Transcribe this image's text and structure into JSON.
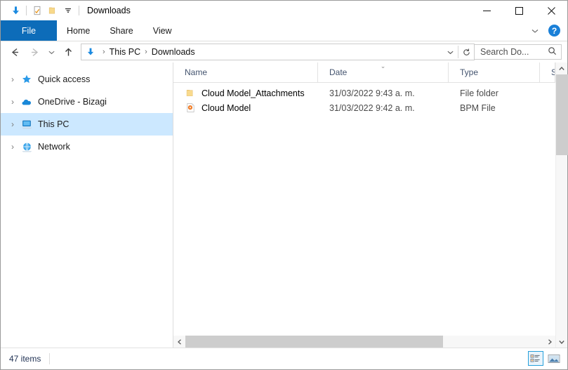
{
  "window": {
    "title": "Downloads",
    "quick_access": [
      {
        "name": "download-icon",
        "label": "Downloads"
      },
      {
        "name": "properties-icon",
        "label": "Properties"
      },
      {
        "name": "new-folder-icon",
        "label": "New folder"
      },
      {
        "name": "customize-qat-icon",
        "label": "Customize Quick Access Toolbar"
      }
    ],
    "controls": {
      "minimize": "—",
      "maximize": "□",
      "close": "✕"
    }
  },
  "ribbon": {
    "tabs": [
      {
        "label": "File",
        "active": true
      },
      {
        "label": "Home",
        "active": false
      },
      {
        "label": "Share",
        "active": false
      },
      {
        "label": "View",
        "active": false
      }
    ],
    "collapse_label": "Minimize the Ribbon",
    "help_label": "?"
  },
  "address": {
    "back_label": "Back",
    "forward_label": "Forward",
    "recent_label": "Recent locations",
    "up_label": "Up one level",
    "breadcrumbs": [
      {
        "label": "This PC"
      },
      {
        "label": "Downloads"
      }
    ],
    "separator": "›",
    "history_label": "Previous locations",
    "refresh_label": "Refresh",
    "search_value": "Search Do..."
  },
  "nav": {
    "items": [
      {
        "label": "Quick access",
        "icon": "star-icon",
        "selected": false
      },
      {
        "label": "OneDrive - Bizagi",
        "icon": "cloud-icon",
        "selected": false
      },
      {
        "label": "This PC",
        "icon": "computer-icon",
        "selected": true
      },
      {
        "label": "Network",
        "icon": "network-icon",
        "selected": false
      }
    ],
    "expander": "›"
  },
  "list": {
    "columns": [
      {
        "label": "Name",
        "sorted": false
      },
      {
        "label": "Date",
        "sorted": true
      },
      {
        "label": "Type",
        "sorted": false
      },
      {
        "label": "S",
        "sorted": false
      }
    ],
    "sort_indicator": "⌄",
    "rows": [
      {
        "name": "Cloud Model_Attachments",
        "date": "31/03/2022 9:43 a. m.",
        "type": "File folder",
        "icon": "folder-icon"
      },
      {
        "name": "Cloud Model",
        "date": "31/03/2022 9:42 a. m.",
        "type": "BPM File",
        "icon": "bpm-file-icon"
      }
    ]
  },
  "status": {
    "item_count": "47 items",
    "details_view_label": "Details view",
    "large_icons_view_label": "Large icons view"
  },
  "colors": {
    "accent": "#0d6cb9",
    "selection": "#cce8ff",
    "folder": "#f6d27f",
    "help": "#1a80d8",
    "scroll_thumb": "#cdcdcd"
  }
}
